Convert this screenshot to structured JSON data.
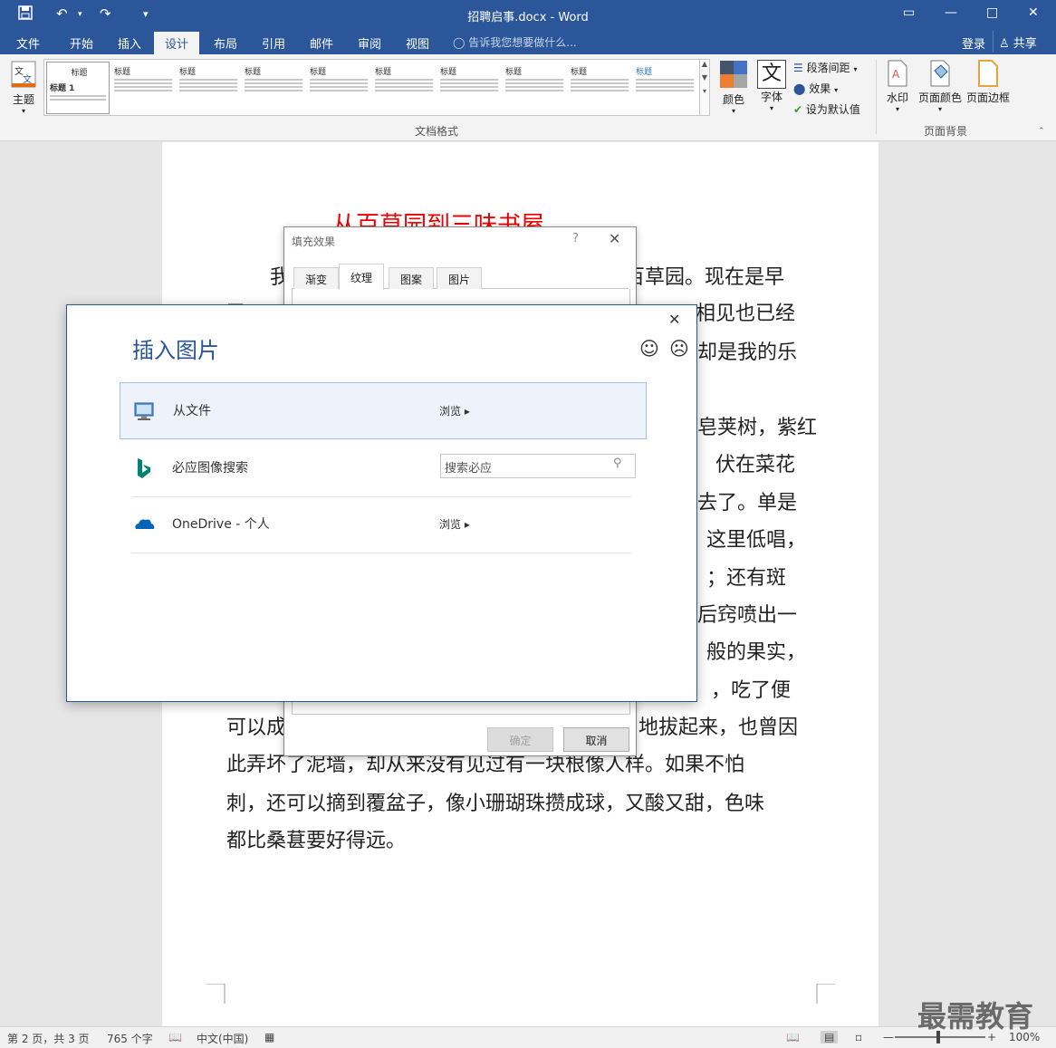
{
  "window": {
    "title": "招聘启事.docx - Word",
    "qa_save_icon": "save-icon",
    "qa_undo_icon": "undo-icon",
    "qa_redo_icon": "redo-icon",
    "min": "—",
    "max": "□",
    "close": "✕",
    "restore": "▭"
  },
  "tabs": {
    "file": "文件",
    "home": "开始",
    "insert": "插入",
    "design": "设计",
    "layout": "布局",
    "references": "引用",
    "mailings": "邮件",
    "review": "审阅",
    "view": "视图",
    "tell": "告诉我您想要做什么...",
    "login": "登录",
    "share": "共享"
  },
  "ribbon": {
    "theme": "主题",
    "gallery_items": [
      "标题 1",
      "标题",
      "标题",
      "标题",
      "标题",
      "标题",
      "标题",
      "标题",
      "标题",
      "标题"
    ],
    "gallery_heading": "标题",
    "colors": "颜色",
    "fonts": "字体",
    "paragraph_spacing": "段落间距",
    "effects": "效果",
    "set_default": "设为默认值",
    "watermark": "水印",
    "page_color": "页面颜色",
    "page_border": "页面边框",
    "group_doc_format": "文档格式",
    "group_page_bg": "页面背景",
    "font_glyph": "文"
  },
  "document": {
    "title": "从百草园到三味书屋",
    "line1_left": "我",
    "line1_right": "百草园。现在是早",
    "line2_left": "已",
    "line2_right": "相见也已经",
    "line3_right": "却是我的乐",
    "line4_right": "皂荚树，紫红",
    "line5_right": "伏在菜花",
    "line6_right": "去了。单是",
    "line7_right": "这里低唱，",
    "line8_right": "；还有斑",
    "line9_right": "后窍喷出一",
    "line10_right": "般的果实，",
    "line11_right": "，吃了便",
    "line12": "可以成",
    "line12_right": "地拔起来，也曾因",
    "line13": "此弄坏了泥墙，却从来没有见过有一块根像人样。如果不怕",
    "line14": "刺，还可以摘到覆盆子，像小珊瑚珠攒成球，又酸又甜，色味",
    "line15": "都比桑葚要好得远。",
    "squig_word": "珊瑚珠攒"
  },
  "fill_dialog": {
    "title": "填充效果",
    "help": "?",
    "close": "✕",
    "tabs": [
      "渐变",
      "纹理",
      "图案",
      "图片"
    ],
    "active_tab": "纹理",
    "ok": "确定",
    "cancel": "取消"
  },
  "insert_picture": {
    "title": "插入图片",
    "close": "✕",
    "smile": "☺",
    "frown": "☹",
    "rows": [
      {
        "label": "从文件",
        "action": "浏览 ▸",
        "icon": "computer-icon"
      },
      {
        "label": "必应图像搜索",
        "placeholder": "搜索必应",
        "icon": "bing-icon"
      },
      {
        "label": "OneDrive - 个人",
        "action": "浏览 ▸",
        "icon": "onedrive-icon"
      }
    ]
  },
  "status": {
    "page": "第 2 页，共 3 页",
    "words": "765 个字",
    "lang": "中文(中国)",
    "zoom": "100%",
    "zoom_minus": "—",
    "zoom_plus": "+"
  },
  "watermark_text": "最需教育"
}
